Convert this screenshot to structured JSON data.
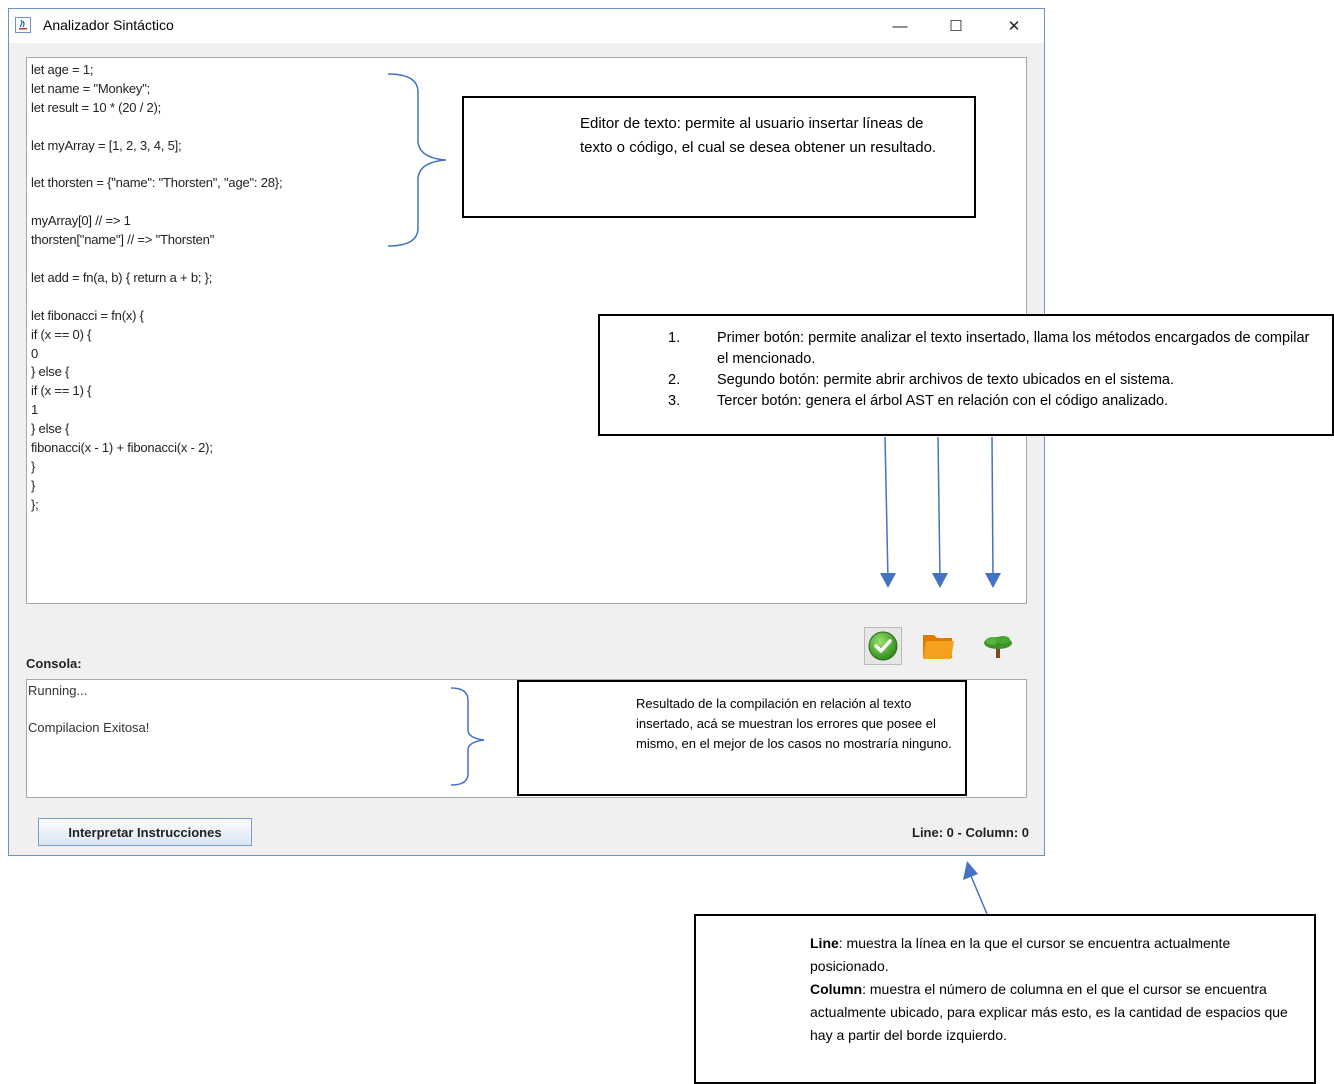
{
  "window": {
    "title": "Analizador Sintáctico",
    "minimize_glyph": "—",
    "maximize_glyph": "☐",
    "close_glyph": "✕"
  },
  "editor": {
    "lines": [
      "let age = 1;",
      "let name = \"Monkey\";",
      "let result = 10 * (20 / 2);",
      "",
      "let myArray = [1, 2, 3, 4, 5];",
      "",
      "let thorsten = {\"name\": \"Thorsten\", \"age\": 28};",
      "",
      "myArray[0] // => 1",
      "thorsten[\"name\"] // => \"Thorsten\"",
      "",
      "let add = fn(a, b) { return a + b; };",
      "",
      "let fibonacci = fn(x) {",
      "if (x == 0) {",
      "0",
      "} else {",
      "if (x == 1) {",
      "1",
      "} else {",
      "fibonacci(x - 1) + fibonacci(x - 2);",
      "}",
      "}",
      "};"
    ]
  },
  "toolbar": {
    "compile_icon": "check-circle-icon",
    "open_icon": "folder-icon",
    "ast_icon": "tree-icon"
  },
  "console": {
    "label": "Consola:",
    "lines": [
      "Running...",
      "",
      "Compilacion Exitosa!"
    ]
  },
  "footer": {
    "interpret_label": "Interpretar Instrucciones",
    "cursor_status": "Line: 0 - Column: 0"
  },
  "annotations": {
    "editor_note": "Editor de texto: permite al usuario insertar líneas de texto o código, el cual se desea obtener un resultado.",
    "buttons_note": [
      {
        "num": "1.",
        "text": "Primer botón: permite analizar el texto insertado, llama los métodos encargados de compilar el mencionado."
      },
      {
        "num": "2.",
        "text": "Segundo botón: permite abrir archivos de texto ubicados en el sistema."
      },
      {
        "num": "3.",
        "text": "Tercer botón: genera el árbol AST en relación con el código analizado."
      }
    ],
    "console_note": "Resultado de la compilación en relación al texto insertado, acá se muestran los errores que posee el mismo, en el mejor de los casos no mostraría ninguno.",
    "status_note": {
      "line_term": "Line",
      "line_desc": ": muestra la línea en la que el cursor se encuentra actualmente posicionado.",
      "column_term": "Column",
      "column_desc": ": muestra el número de columna en el que el cursor se encuentra actualmente ubicado, para explicar más esto, es la cantidad de espacios que hay a partir del borde izquierdo."
    }
  },
  "colors": {
    "arrow": "#4472c4",
    "window_border": "#6f8fc9"
  }
}
